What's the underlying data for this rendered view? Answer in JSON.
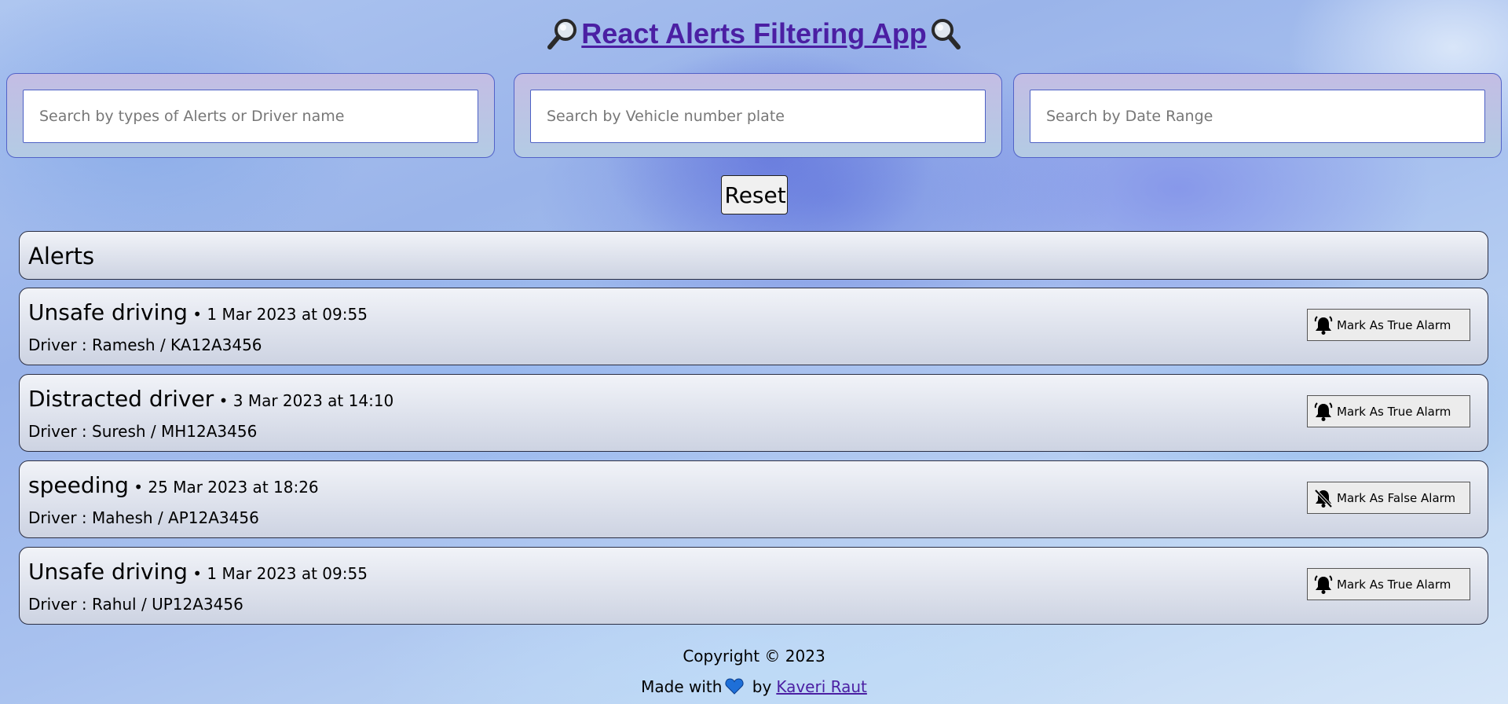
{
  "header": {
    "title": "React Alerts Filtering App",
    "left_icon": "magnifier-left-icon",
    "right_icon": "magnifier-right-icon"
  },
  "filters": {
    "alert_or_driver_placeholder": "Search by types of Alerts or Driver name",
    "vehicle_placeholder": "Search by Vehicle number plate",
    "date_range_placeholder": "Search by Date Range",
    "reset_label": "Reset"
  },
  "alerts": {
    "heading": "Alerts",
    "items": [
      {
        "type": "Unsafe driving",
        "meta": " • 1 Mar 2023 at 09:55",
        "driver": "Driver : Ramesh / KA12A3456",
        "action": "Mark As True Alarm",
        "icon": "bell-ringing-icon"
      },
      {
        "type": "Distracted driver",
        "meta": " • 3 Mar 2023 at 14:10",
        "driver": "Driver : Suresh / MH12A3456",
        "action": "Mark As True Alarm",
        "icon": "bell-ringing-icon"
      },
      {
        "type": "speeding",
        "meta": " • 25 Mar 2023 at 18:26",
        "driver": "Driver : Mahesh / AP12A3456",
        "action": "Mark As False Alarm",
        "icon": "bell-slash-icon"
      },
      {
        "type": "Unsafe driving",
        "meta": " • 1 Mar 2023 at 09:55",
        "driver": "Driver : Rahul / UP12A3456",
        "action": "Mark As True Alarm",
        "icon": "bell-ringing-icon"
      }
    ]
  },
  "footer": {
    "copyright": "Copyright © 2023",
    "made_with": "Made with",
    "by": " by",
    "author": "Kaveri Raut",
    "heart_color": "#1e6fd8"
  },
  "colors": {
    "title": "#4b1fa3",
    "input_border": "#4d61c5"
  }
}
